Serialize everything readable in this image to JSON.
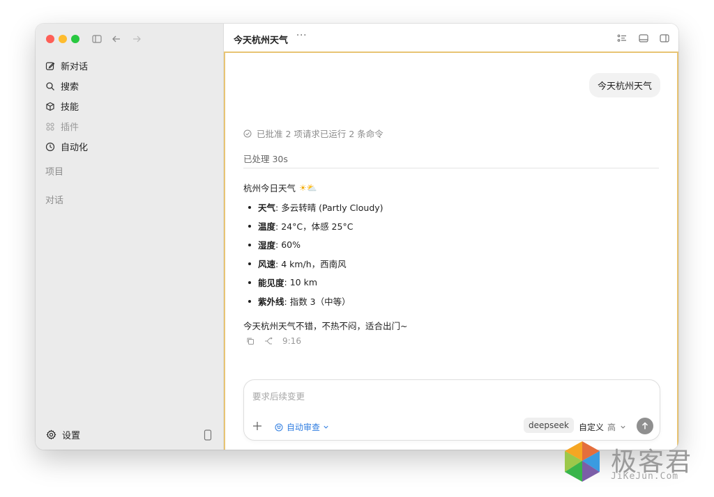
{
  "sidebar": {
    "items": [
      {
        "label": "新对话",
        "icon": "edit-icon"
      },
      {
        "label": "搜索",
        "icon": "search-icon"
      },
      {
        "label": "技能",
        "icon": "cube-icon"
      },
      {
        "label": "插件",
        "icon": "grid-icon"
      },
      {
        "label": "自动化",
        "icon": "clock-icon"
      }
    ],
    "projects_label": "项目",
    "chats_label": "对话",
    "settings_label": "设置"
  },
  "header": {
    "title": "今天杭州天气",
    "more": "···"
  },
  "chat": {
    "user_message": "今天杭州天气",
    "approved_status": "已批准 2 项请求已运行 2 条命令",
    "processed": "已处理 30s",
    "answer_title": "杭州今日天气",
    "answer_emoji": "☀⛅",
    "bullets": [
      {
        "key": "天气",
        "value": ": 多云转晴 (Partly Cloudy)"
      },
      {
        "key": "温度",
        "value": ": 24°C，体感 25°C"
      },
      {
        "key": "湿度",
        "value": ": 60%"
      },
      {
        "key": "风速",
        "value": ": 4 km/h，西南风"
      },
      {
        "key": "能见度",
        "value": ": 10 km"
      },
      {
        "key": "紫外线",
        "value": ": 指数 3（中等）"
      }
    ],
    "closing": "今天杭州天气不错，不热不闷，适合出门~",
    "time": "9:16"
  },
  "composer": {
    "placeholder": "要求后续变更",
    "auto_review": "自动审查",
    "model": "deepseek",
    "custom": "自定义",
    "level": "高"
  },
  "watermark": {
    "text": "极客君",
    "sub": "JiKeJun.Com"
  },
  "colors": {
    "accent_border": "#e8c473",
    "link_blue": "#2f7de1",
    "sidebar_bg": "#ebebeb"
  }
}
